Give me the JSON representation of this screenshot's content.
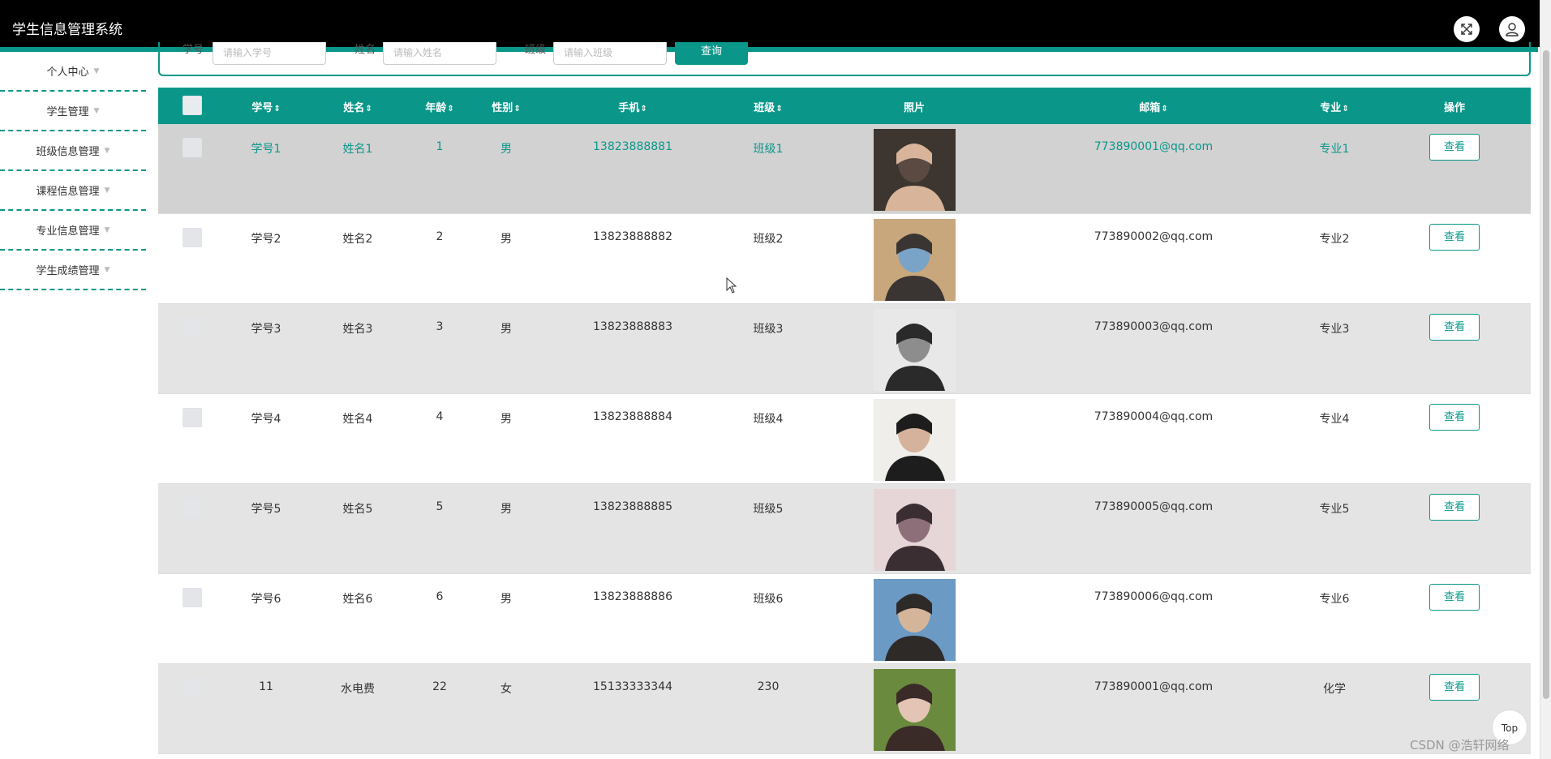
{
  "app": {
    "title": "学生信息管理系统"
  },
  "header": {
    "fullscreen_icon": "expand-icon",
    "user_icon": "user-icon"
  },
  "sidebar": {
    "items": [
      {
        "label": "个人中心"
      },
      {
        "label": "学生管理"
      },
      {
        "label": "班级信息管理"
      },
      {
        "label": "课程信息管理"
      },
      {
        "label": "专业信息管理"
      },
      {
        "label": "学生成绩管理"
      }
    ]
  },
  "search": {
    "fields": [
      {
        "label": "学号",
        "placeholder": "请输入学号"
      },
      {
        "label": "姓名",
        "placeholder": "请输入姓名"
      },
      {
        "label": "班级",
        "placeholder": "请输入班级"
      }
    ],
    "button": "查询"
  },
  "table": {
    "headers": [
      "学号",
      "姓名",
      "年龄",
      "性别",
      "手机",
      "班级",
      "照片",
      "邮箱",
      "专业",
      "操作"
    ],
    "view_label": "查看",
    "rows": [
      {
        "id": "学号1",
        "name": "姓名1",
        "age": "1",
        "gender": "男",
        "phone": "13823888881",
        "class": "班级1",
        "email": "773890001@qq.com",
        "major": "专业1"
      },
      {
        "id": "学号2",
        "name": "姓名2",
        "age": "2",
        "gender": "男",
        "phone": "13823888882",
        "class": "班级2",
        "email": "773890002@qq.com",
        "major": "专业2"
      },
      {
        "id": "学号3",
        "name": "姓名3",
        "age": "3",
        "gender": "男",
        "phone": "13823888883",
        "class": "班级3",
        "email": "773890003@qq.com",
        "major": "专业3"
      },
      {
        "id": "学号4",
        "name": "姓名4",
        "age": "4",
        "gender": "男",
        "phone": "13823888884",
        "class": "班级4",
        "email": "773890004@qq.com",
        "major": "专业4"
      },
      {
        "id": "学号5",
        "name": "姓名5",
        "age": "5",
        "gender": "男",
        "phone": "13823888885",
        "class": "班级5",
        "email": "773890005@qq.com",
        "major": "专业5"
      },
      {
        "id": "学号6",
        "name": "姓名6",
        "age": "6",
        "gender": "男",
        "phone": "13823888886",
        "class": "班级6",
        "email": "773890006@qq.com",
        "major": "专业6"
      },
      {
        "id": "11",
        "name": "水电费",
        "age": "22",
        "gender": "女",
        "phone": "15133333344",
        "class": "230",
        "email": "773890001@qq.com",
        "major": "化学"
      }
    ]
  },
  "back_to_top": "Top",
  "watermark": "CSDN @浩轩网络",
  "colors": {
    "accent": "#0a9789",
    "topbar": "#000000"
  }
}
